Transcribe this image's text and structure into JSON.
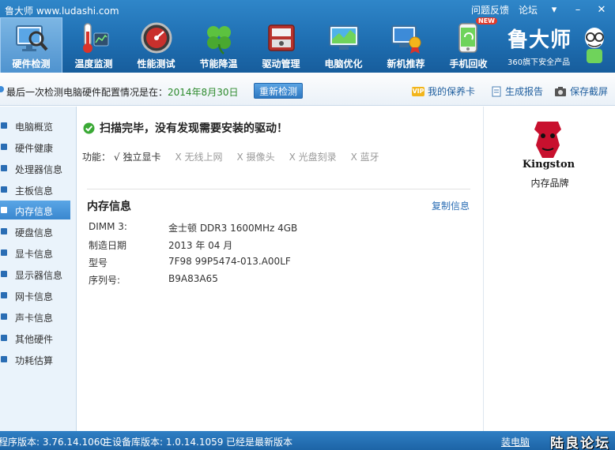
{
  "window": {
    "title": "鲁大师 www.ludashi.com",
    "feedback": "问题反馈",
    "forum": "论坛",
    "menu_glyph": "▾",
    "minimize_glyph": "–",
    "close_glyph": "✕"
  },
  "toolbar": {
    "items": [
      {
        "label": "硬件检测",
        "icon": "monitor-magnifier-icon"
      },
      {
        "label": "温度监测",
        "icon": "thermometer-icon"
      },
      {
        "label": "性能测试",
        "icon": "speedometer-icon"
      },
      {
        "label": "节能降温",
        "icon": "clover-leaf-icon"
      },
      {
        "label": "驱动管理",
        "icon": "driver-box-icon"
      },
      {
        "label": "电脑优化",
        "icon": "optimize-monitor-icon"
      },
      {
        "label": "新机推荐",
        "icon": "new-computer-icon"
      },
      {
        "label": "手机回收",
        "icon": "phone-recycle-icon"
      }
    ],
    "active_index": 0,
    "new_badge": "NEW"
  },
  "brand": {
    "name": "鲁大师",
    "subtitle": "360旗下安全产品"
  },
  "infobar": {
    "last_check_prefix": "最后一次检测电脑硬件配置情况是在：",
    "last_check_date": "2014年8月30日",
    "recheck_button": "重新检测",
    "vip_badge": "VIP",
    "warranty_card": "我的保养卡",
    "generate_report": "生成报告",
    "save_screenshot": "保存截屏"
  },
  "sidebar": {
    "items": [
      "电脑概览",
      "硬件健康",
      "处理器信息",
      "主板信息",
      "内存信息",
      "硬盘信息",
      "显卡信息",
      "显示器信息",
      "网卡信息",
      "声卡信息",
      "其他硬件",
      "功耗估算"
    ],
    "active_index": 4
  },
  "main": {
    "scan_status": "扫描完毕，没有发现需要安装的驱动！",
    "features_label": "功能：",
    "features": [
      {
        "text": "√ 独立显卡",
        "enabled": true
      },
      {
        "text": "X 无线上网",
        "enabled": false
      },
      {
        "text": "X 摄像头",
        "enabled": false
      },
      {
        "text": "X 光盘刻录",
        "enabled": false
      },
      {
        "text": "X 蓝牙",
        "enabled": false
      }
    ],
    "section_title": "内存信息",
    "copy_info": "复制信息",
    "details": [
      {
        "key": "DIMM 3:",
        "value": "金士顿 DDR3 1600MHz 4GB"
      },
      {
        "key": "制造日期",
        "value": "2013 年 04 月"
      },
      {
        "key": "型号",
        "value": "7F98 99P5474-013.A00LF"
      },
      {
        "key": "序列号:",
        "value": "B9A83A65"
      }
    ]
  },
  "right_panel": {
    "logo_text": "Kingston",
    "label": "内存品牌"
  },
  "statusbar": {
    "program_version": "程序版本: 3.76.14.1060",
    "db_version": "主设备库版本: 1.0.14.1059",
    "latest": "已经是最新版本",
    "install_link": "装电脑",
    "watermark": "陆良论坛"
  },
  "colors": {
    "toolbar_blue": "#1f6fb2",
    "active_sidebar": "#3a87cf",
    "date_green": "#2c8a2c",
    "link_blue": "#2a6db4",
    "kingston_red": "#c8102e"
  }
}
